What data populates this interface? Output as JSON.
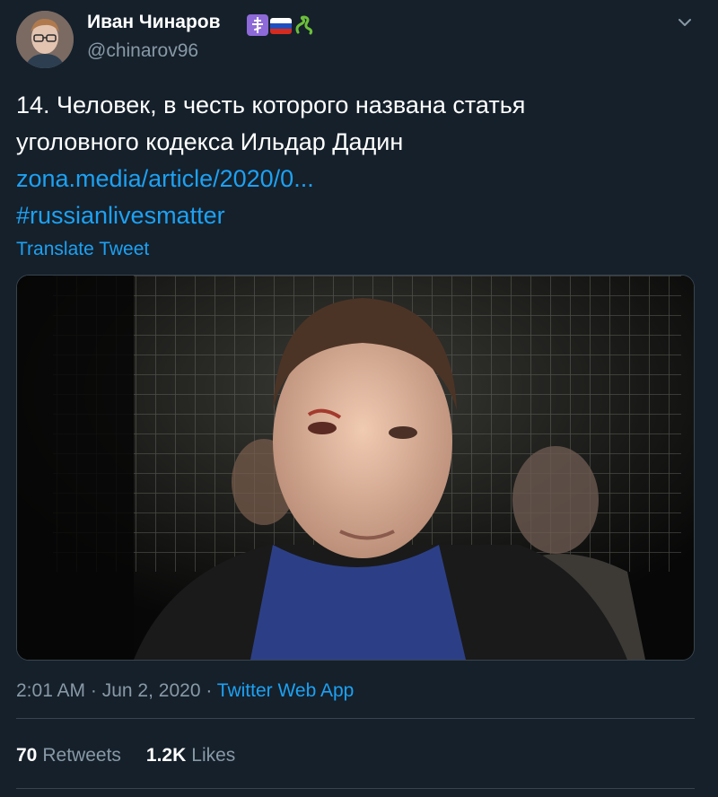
{
  "author": {
    "display_name": "Иван Чинаров",
    "handle": "@chinarov96"
  },
  "tweet": {
    "text_lines": [
      "14. Человек, в честь которого названа статья",
      "уголовного кодекса Ильдар Дадин"
    ],
    "link": "zona.media/article/2020/0...",
    "hashtag": "#russianlivesmatter",
    "translate_label": "Translate Tweet"
  },
  "meta": {
    "time": "2:01 AM",
    "separator1": " · ",
    "date": "Jun 2, 2020",
    "separator2": " · ",
    "source": "Twitter Web App"
  },
  "stats": {
    "retweets_count": "70",
    "retweets_label": "Retweets",
    "likes_count": "1.2K",
    "likes_label": "Likes"
  },
  "colors": {
    "background": "#15202b",
    "accent": "#1da1f2",
    "secondary_text": "#8899a6",
    "border": "#38444d"
  },
  "icons": [
    "orthodox-cross-emoji-icon",
    "russian-flag-emoji-icon",
    "snake-emoji-icon",
    "chevron-down-icon"
  ]
}
